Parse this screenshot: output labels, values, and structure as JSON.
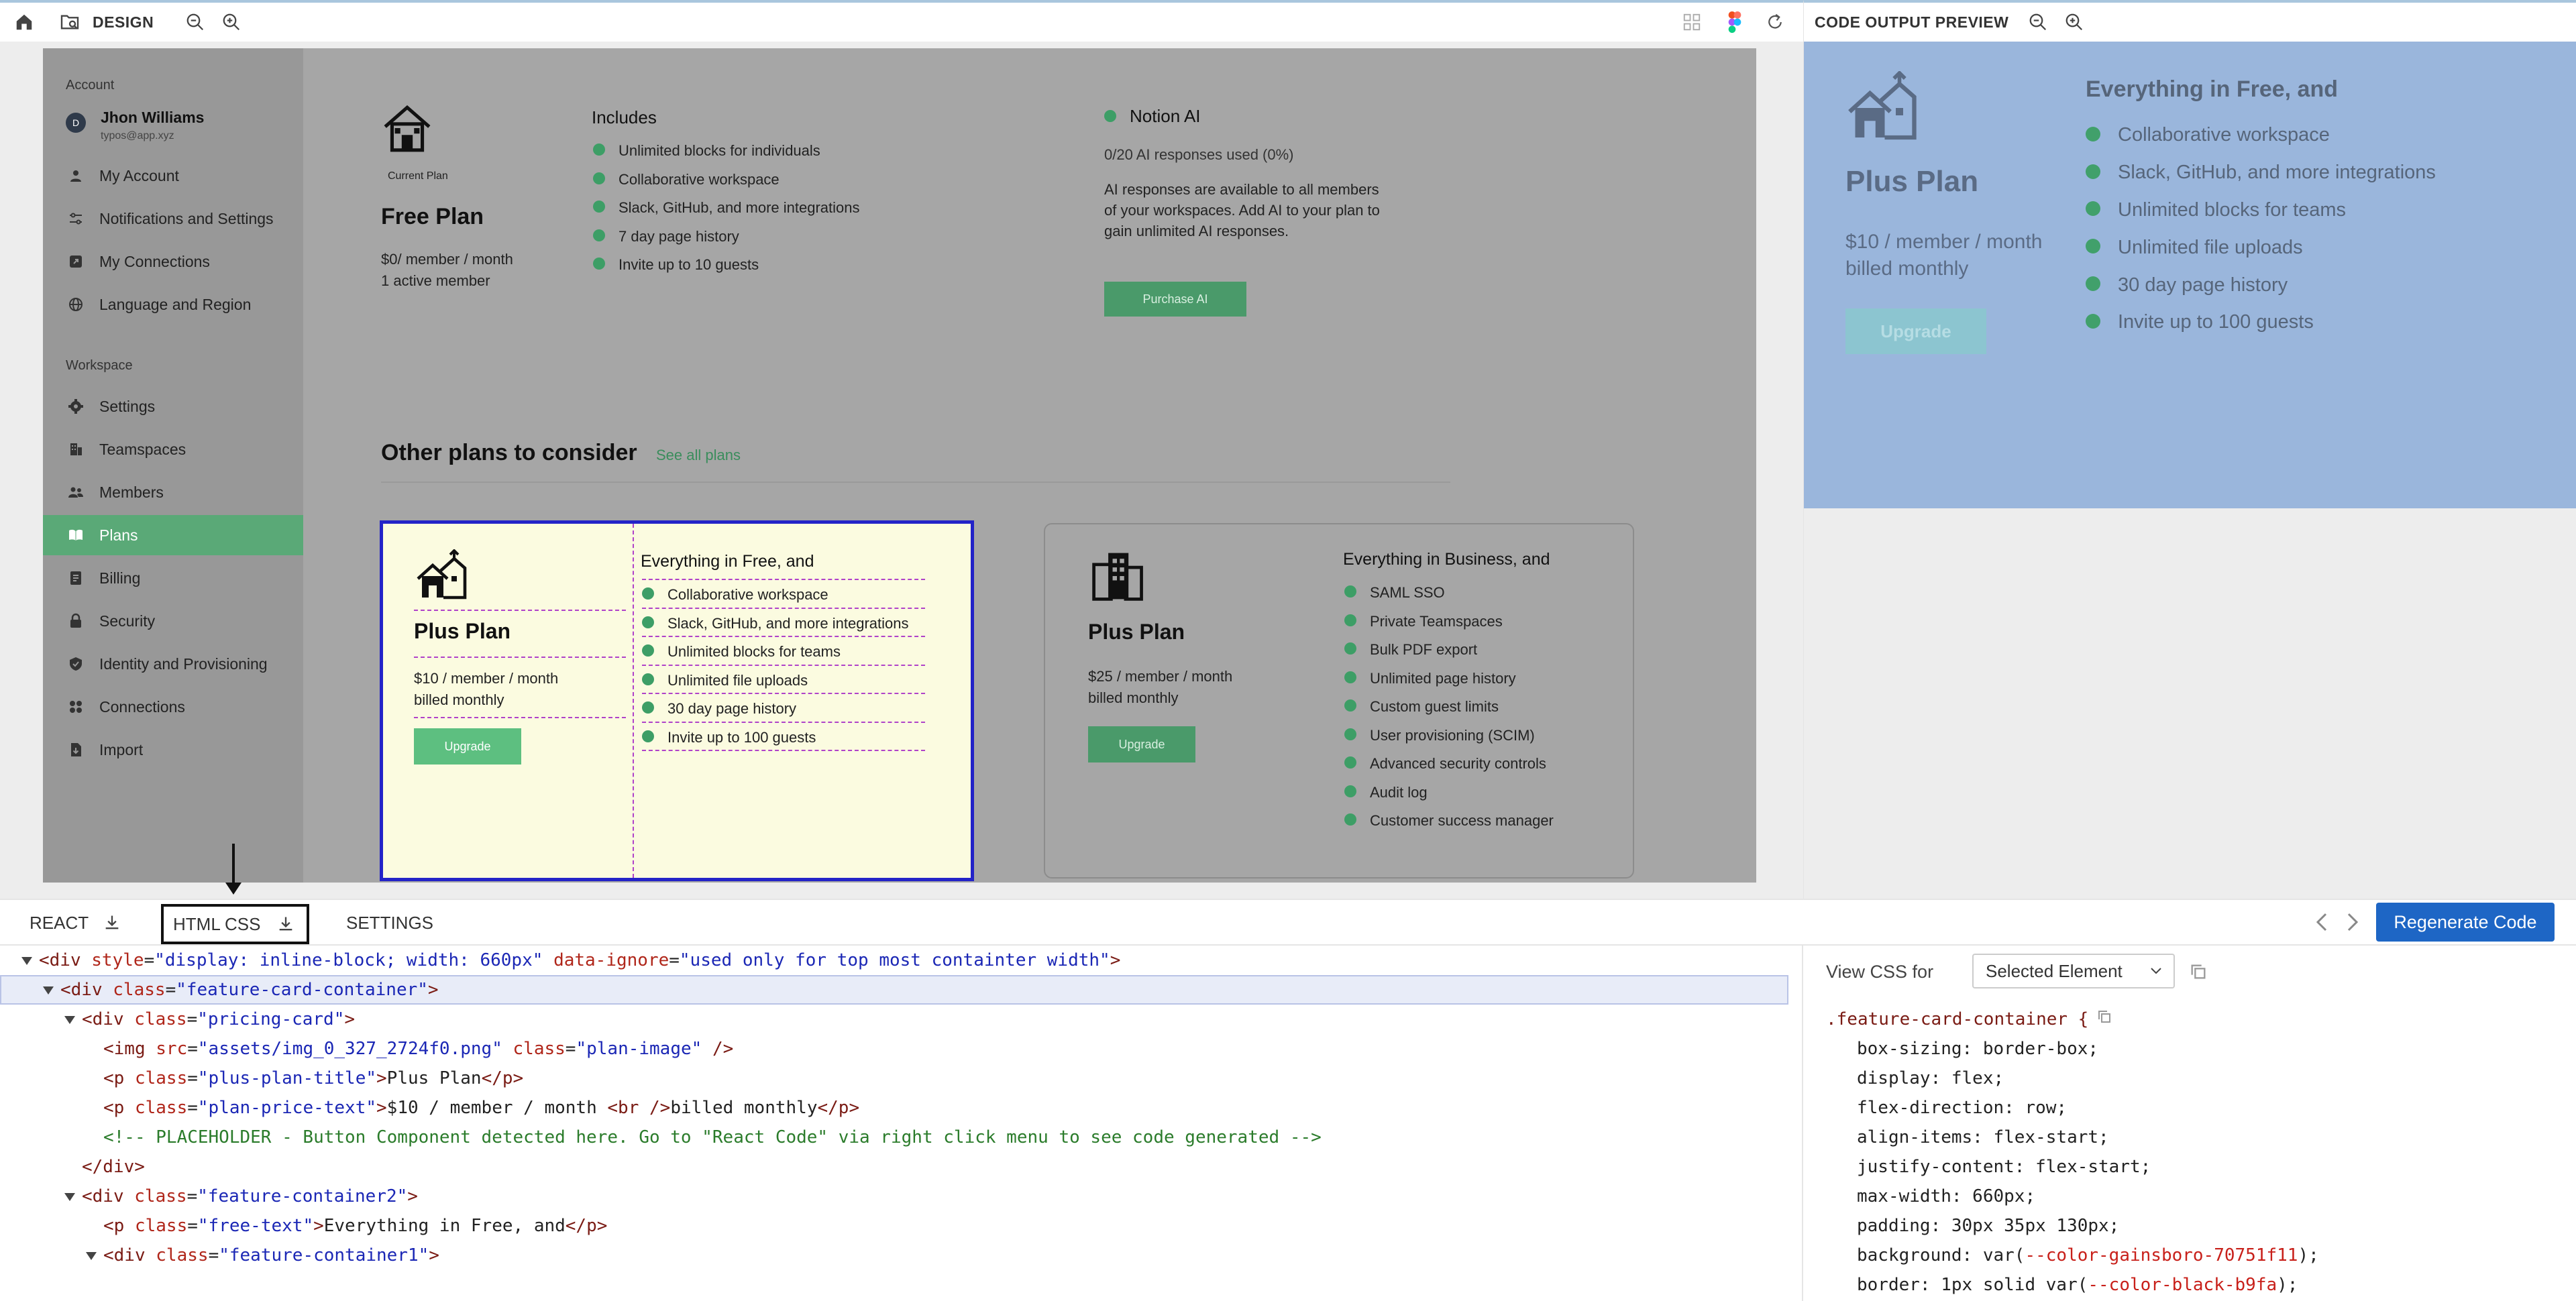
{
  "toolbar": {
    "design_label": "DESIGN",
    "preview_label": "CODE OUTPUT PREVIEW"
  },
  "sidebar": {
    "account_heading": "Account",
    "user_initial": "D",
    "user_name": "Jhon Williams",
    "user_email": "typos@app.xyz",
    "account_items": [
      {
        "label": "My Account",
        "icon": "user-icon"
      },
      {
        "label": "Notifications and Settings",
        "icon": "sliders-icon"
      },
      {
        "label": "My Connections",
        "icon": "arrow-box-icon"
      },
      {
        "label": "Language and Region",
        "icon": "globe-icon"
      }
    ],
    "workspace_heading": "Workspace",
    "workspace_items": [
      {
        "label": "Settings",
        "icon": "gear-icon"
      },
      {
        "label": "Teamspaces",
        "icon": "building-icon"
      },
      {
        "label": "Members",
        "icon": "members-icon"
      },
      {
        "label": "Plans",
        "icon": "book-icon",
        "active": true
      },
      {
        "label": "Billing",
        "icon": "billing-icon"
      },
      {
        "label": "Security",
        "icon": "lock-icon"
      },
      {
        "label": "Identity and Provisioning",
        "icon": "shield-icon"
      },
      {
        "label": "Connections",
        "icon": "grid-icon"
      },
      {
        "label": "Import",
        "icon": "import-icon"
      }
    ]
  },
  "current_plan": {
    "badge": "Current Plan",
    "name": "Free Plan",
    "price_line1": "$0/ member / month",
    "price_line2": "1 active member",
    "includes_heading": "Includes",
    "includes": [
      "Unlimited blocks for individuals",
      "Collaborative workspace",
      "Slack, GitHub, and more integrations",
      "7 day page history",
      "Invite up to 10 guests"
    ]
  },
  "notion_ai": {
    "title": "Notion AI",
    "usage": "0/20 AI responses used (0%)",
    "desc_line1": "AI responses are available to all members",
    "desc_line2": "of your workspaces. Add AI to your plan to",
    "desc_line3": "gain unlimited AI responses.",
    "button": "Purchase AI"
  },
  "other_plans": {
    "heading": "Other plans to consider",
    "see_all": "See all plans"
  },
  "plus_card": {
    "name": "Plus Plan",
    "price_line1": "$10 / member / month",
    "price_line2": "billed monthly",
    "button": "Upgrade",
    "features_heading": "Everything in Free, and",
    "features": [
      "Collaborative workspace",
      "Slack, GitHub, and more integrations",
      "Unlimited blocks for teams",
      "Unlimited file uploads",
      "30 day page history",
      "Invite up to 100 guests"
    ]
  },
  "business_card": {
    "name": "Plus Plan",
    "price_line1": "$25 / member / month",
    "price_line2": "billed monthly",
    "button": "Upgrade",
    "features_heading": "Everything in Business, and",
    "features": [
      "SAML SSO",
      "Private Teamspaces",
      "Bulk PDF export",
      "Unlimited page history",
      "Custom guest limits",
      "User provisioning (SCIM)",
      "Advanced security controls",
      "Audit log",
      "Customer success manager"
    ]
  },
  "code_tabs": {
    "react": "REACT",
    "html_css": "HTML CSS",
    "settings": "SETTINGS",
    "regenerate": "Regenerate Code"
  },
  "code_lines": [
    [
      "<div ",
      "style",
      "=",
      "\"display: inline-block; width: 660px\"",
      " ",
      "data-ignore",
      "=",
      "\"used only for top most containter width\"",
      ">"
    ],
    [
      "<div ",
      "class",
      "=",
      "\"feature-card-container\"",
      ">"
    ],
    [
      "<div ",
      "class",
      "=",
      "\"pricing-card\"",
      ">"
    ],
    [
      "<img ",
      "src",
      "=",
      "\"assets/img_0_327_2724f0.png\"",
      " ",
      "class",
      "=",
      "\"plan-image\"",
      " />"
    ],
    [
      "<p ",
      "class",
      "=",
      "\"plus-plan-title\"",
      ">",
      "Plus Plan",
      "</p>"
    ],
    [
      "<p ",
      "class",
      "=",
      "\"plan-price-text\"",
      ">",
      "$10 / member / month ",
      "<br />",
      "billed monthly",
      "</p>"
    ],
    [
      "<!-- PLACEHOLDER - Button Component detected here. Go to \"React Code\" via right click menu to see code generated -->"
    ],
    [
      "</div>"
    ],
    [
      "<div ",
      "class",
      "=",
      "\"feature-container2\"",
      ">"
    ],
    [
      "<p ",
      "class",
      "=",
      "\"free-text\"",
      ">",
      "Everything in Free, and",
      "</p>"
    ],
    [
      "<div ",
      "class",
      "=",
      "\"feature-container1\"",
      ">"
    ]
  ],
  "css_panel": {
    "view_css_for": "View CSS for",
    "selected_option": "Selected Element",
    "selector": ".feature-card-container {",
    "properties": [
      "box-sizing: border-box;",
      "display: flex;",
      "flex-direction: row;",
      "align-items: flex-start;",
      "justify-content: flex-start;",
      "max-width: 660px;",
      "padding: 30px 35px 130px;"
    ],
    "background_prefix": "background: var(",
    "background_var": "--color-gainsboro-70751f11",
    "background_suffix": ");",
    "border_prefix": "border: 1px solid var(",
    "border_var": "--color-black-b9fa",
    "border_suffix": ");"
  },
  "colors": {
    "accent_blue": "#1e66c5",
    "plan_green": "#5aa977",
    "selection_border": "#2323c8",
    "preview_bg": "#9ab6dc"
  }
}
